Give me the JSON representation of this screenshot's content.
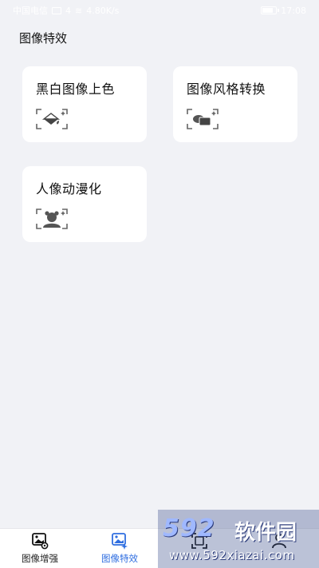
{
  "status_bar": {
    "carrier": "中国电信",
    "network": "4",
    "speed": "4.80K/s",
    "time": "17:08"
  },
  "page": {
    "title": "图像特效"
  },
  "cards": [
    {
      "label": "黑白图像上色",
      "icon": "colorize-icon"
    },
    {
      "label": "图像风格转换",
      "icon": "style-transfer-icon"
    },
    {
      "label": "人像动漫化",
      "icon": "anime-portrait-icon"
    }
  ],
  "tab_bar": {
    "tabs": [
      {
        "label": "图像增强",
        "icon": "image-enhance-icon",
        "active": false
      },
      {
        "label": "图像特效",
        "icon": "image-effects-icon",
        "active": true
      },
      {
        "label": "",
        "icon": "scan-icon",
        "active": false
      },
      {
        "label": "",
        "icon": "mine-icon",
        "active": false
      }
    ]
  },
  "watermark": {
    "logo": "592",
    "name": "软件园",
    "url": "www.592xiazai.com"
  },
  "colors": {
    "background": "#f1f2f6",
    "card": "#ffffff",
    "active_tab": "#2f6ee0",
    "icon_gray": "#666666"
  }
}
